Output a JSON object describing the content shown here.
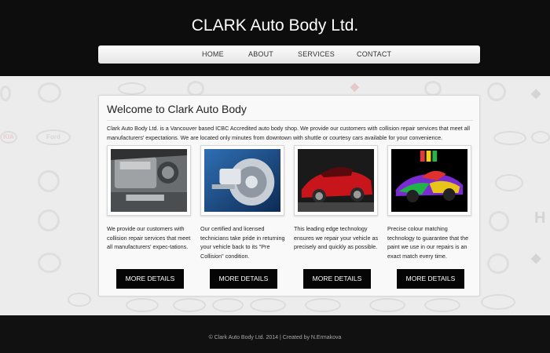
{
  "header": {
    "title": "CLARK Auto Body Ltd.",
    "nav": [
      {
        "label": "HOME"
      },
      {
        "label": "ABOUT"
      },
      {
        "label": "SERVICES"
      },
      {
        "label": "CONTACT"
      }
    ]
  },
  "background": {
    "logos": [
      {
        "icon": "mazda-logo-icon"
      },
      {
        "icon": "ford-logo-icon",
        "text": "Ford"
      },
      {
        "icon": "kia-logo-icon",
        "text": "KIA"
      },
      {
        "icon": "mercedes-logo-icon"
      },
      {
        "icon": "audi-logo-icon"
      },
      {
        "icon": "honda-logo-icon",
        "text": "H"
      },
      {
        "icon": "renault-logo-icon"
      },
      {
        "icon": "chevrolet-logo-icon"
      },
      {
        "icon": "volkswagen-logo-icon",
        "text": "VW"
      }
    ]
  },
  "main": {
    "heading": "Welcome to Clark Auto Body",
    "intro": "Clark Auto Body Ltd. is a Vancouver based ICBC Accredited auto body shop. We provide our customers with collision repair services that meet all manufacturers' expectations. We are located only minutes from downtown with shuttle or courtesy cars available for your convenience.",
    "cards": [
      {
        "image": "engine-bay-photo",
        "text": "We provide our customers with collision repair services that meet all manufacturers' expec-tations.",
        "button": "MORE DETAILS"
      },
      {
        "image": "brake-disc-photo",
        "text": "Our certified and licensed technicians take pride in returning your vehicle back to its \"Pre Collision\" condition.",
        "button": "MORE DETAILS"
      },
      {
        "image": "red-sports-car-photo",
        "text": "This leading edge technology ensures we repair your vehicle as precisely and quickly as possible.",
        "button": "MORE DETAILS"
      },
      {
        "image": "paint-colours-car-photo",
        "text": "Precise colour matching technology to guarantee that the paint we use in our repairs is an exact match every time.",
        "button": "MORE DETAILS"
      }
    ]
  },
  "footer": {
    "text": "© Clark Auto Body Ltd. 2014 | Created by N.Ermakova"
  },
  "colors": {
    "header_bg": "#0d0d0d",
    "button_bg": "#050505",
    "page_bg": "#ececec",
    "panel_bg": "#f9f9f9"
  }
}
